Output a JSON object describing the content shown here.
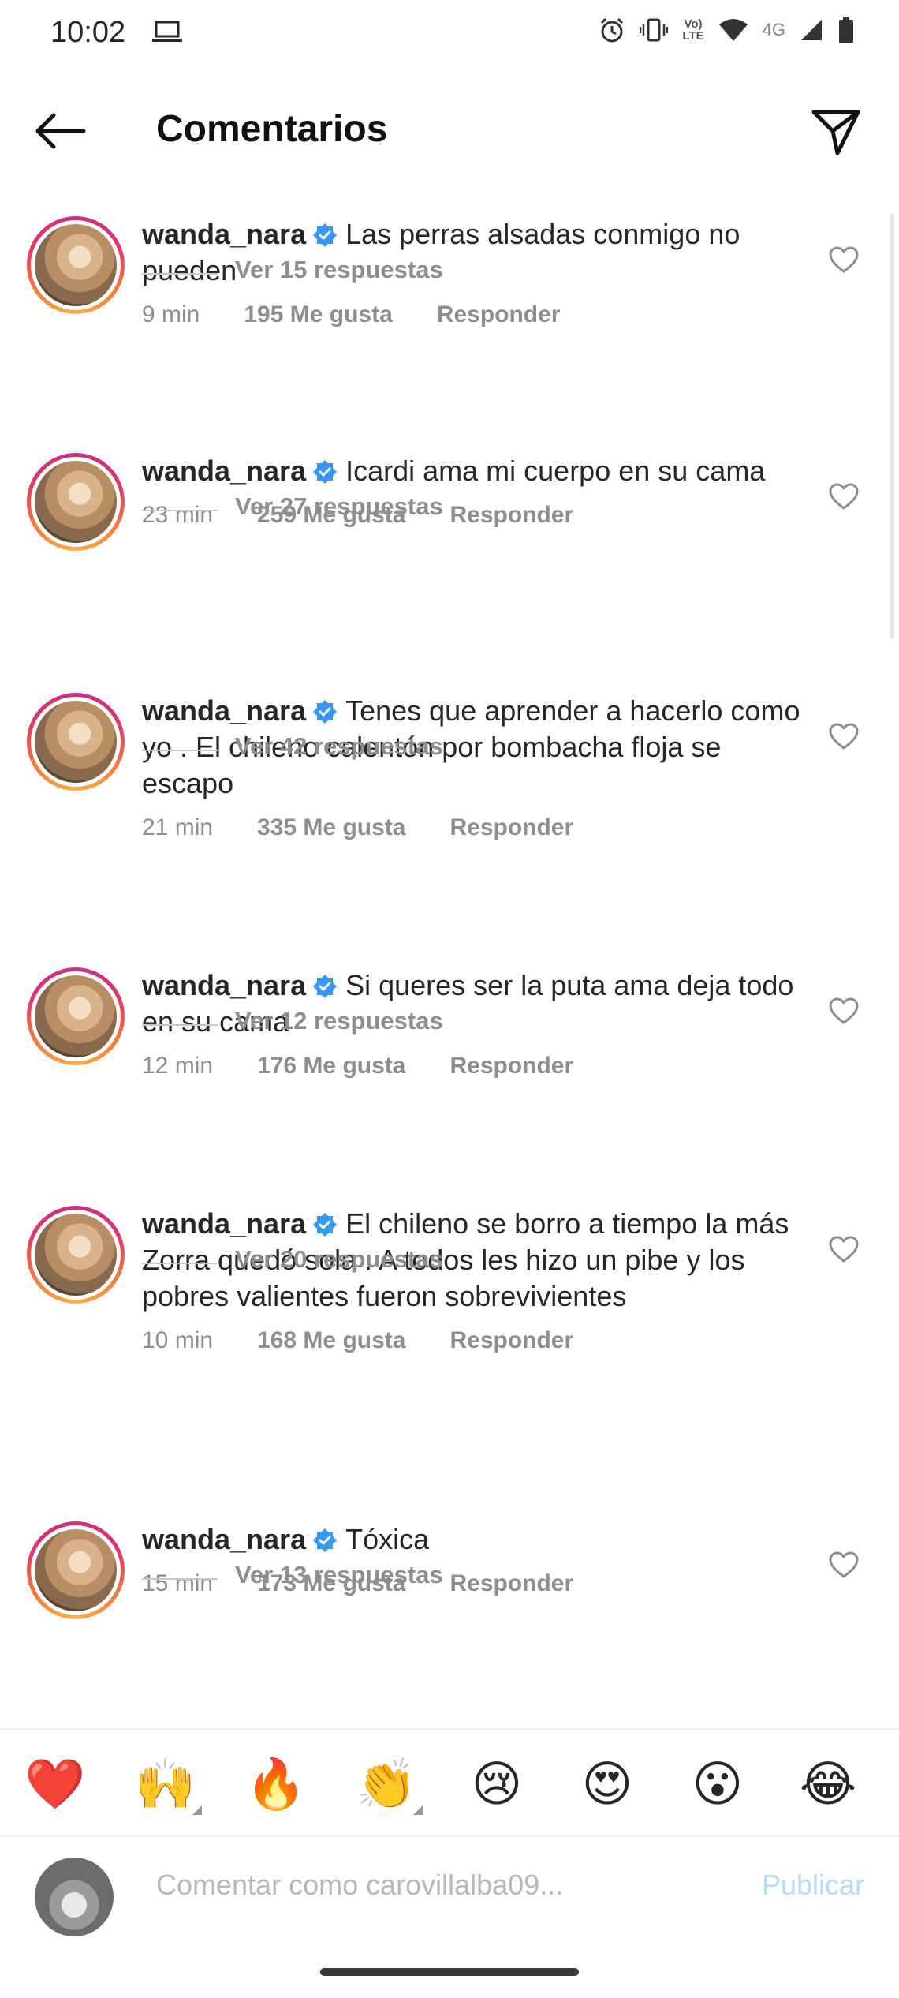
{
  "status_bar": {
    "time": "10:02",
    "volte_top": "Vo)",
    "volte_bottom": "LTE",
    "network": "4G",
    "icons": [
      "laptop-icon",
      "alarm-icon",
      "vibrate-icon",
      "wifi-icon",
      "signal-icon",
      "battery-icon"
    ]
  },
  "header": {
    "title": "Comentarios",
    "back_icon": "arrow-left-icon",
    "share_icon": "send-icon"
  },
  "comments": [
    {
      "username": "wanda_nara",
      "text": "Las perras alsadas conmigo no pueden",
      "time": "9 min",
      "likes": "195 Me gusta",
      "reply_label": "Responder",
      "replies_label": "Ver 15 respuestas"
    },
    {
      "username": "wanda_nara",
      "text": "Icardi ama mi cuerpo en su cama",
      "time": "23 min",
      "likes": "259 Me gusta",
      "reply_label": "Responder",
      "replies_label": "Ver 27 respuestas"
    },
    {
      "username": "wanda_nara",
      "text": "Tenes que aprender a hacerlo como yo . El chileno calentón por bombacha floja se escapo",
      "time": "21 min",
      "likes": "335 Me gusta",
      "reply_label": "Responder",
      "replies_label": "Ver 42 respuestas"
    },
    {
      "username": "wanda_nara",
      "text": "Si queres ser la puta ama deja todo en su cama",
      "time": "12 min",
      "likes": "176 Me gusta",
      "reply_label": "Responder",
      "replies_label": "Ver 12 respuestas"
    },
    {
      "username": "wanda_nara",
      "text": "El chileno se borro a tiempo la más Zorra quedó sola . A todos les hizo un pibe y los pobres valientes fueron sobrevivientes",
      "time": "10 min",
      "likes": "168 Me gusta",
      "reply_label": "Responder",
      "replies_label": "Ver 20 respuestas"
    },
    {
      "username": "wanda_nara",
      "text": "Tóxica",
      "time": "15 min",
      "likes": "173 Me gusta",
      "reply_label": "Responder",
      "replies_label": "Ver 13 respuestas"
    }
  ],
  "reactions": [
    "❤️",
    "🙌",
    "🔥",
    "👏",
    "😢",
    "😍",
    "😮",
    "😂"
  ],
  "composer": {
    "placeholder": "Comentar como carovillalba09...",
    "publish_label": "Publicar"
  },
  "colors": {
    "verified": "#3897f0",
    "muted": "#8e8e8e",
    "publish_disabled": "#b6dbfb"
  }
}
